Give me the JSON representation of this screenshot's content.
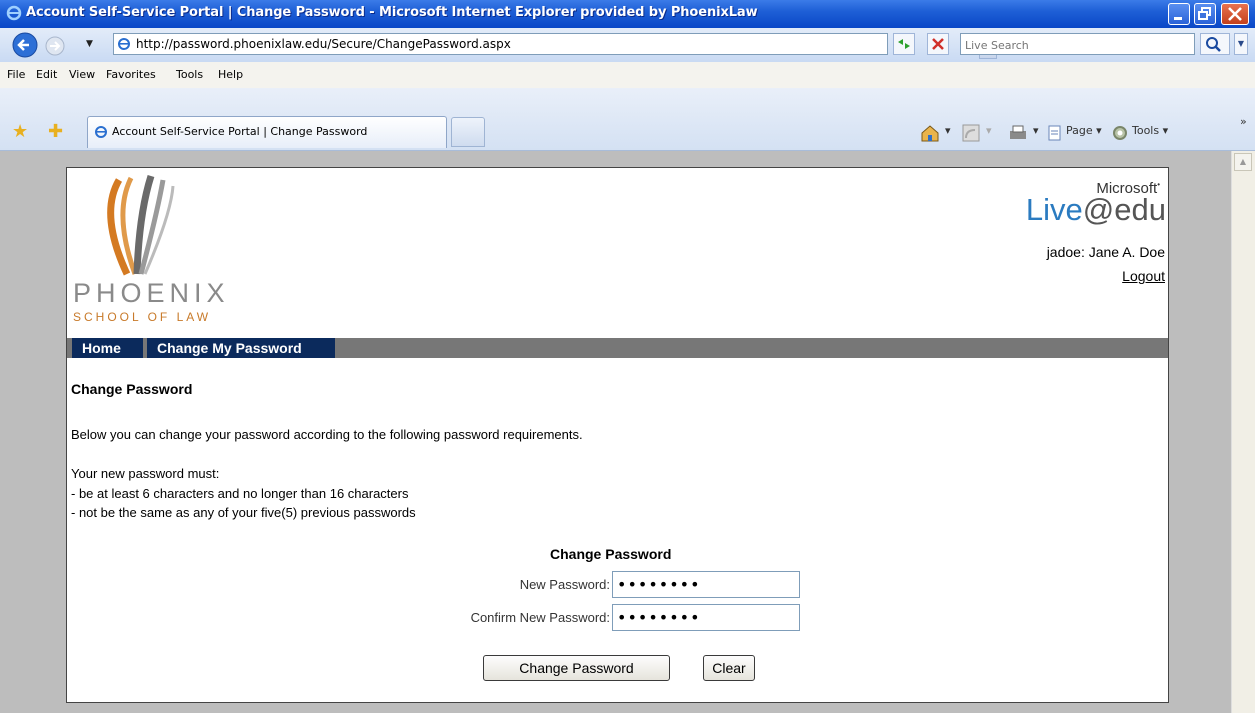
{
  "window": {
    "title": "Account Self-Service Portal | Change Password - Microsoft Internet Explorer provided by PhoenixLaw"
  },
  "address_bar": {
    "url": "http://password.phoenixlaw.edu/Secure/ChangePassword.aspx",
    "search_placeholder": "Live Search"
  },
  "menu": {
    "items": [
      "File",
      "Edit",
      "View",
      "Favorites",
      "Tools",
      "Help"
    ]
  },
  "tabs": {
    "active_label": "Account Self-Service Portal | Change Password"
  },
  "command_bar": {
    "page_label": "Page",
    "tools_label": "Tools",
    "more_label": "»"
  },
  "site": {
    "logo_name": "PHOENIX",
    "logo_sub": "SCHOOL OF LAW",
    "brand_microsoft": "Microsoft",
    "brand_live": "Live",
    "brand_at": "@edu",
    "user_text": "jadoe: Jane A. Doe",
    "logout_label": "Logout"
  },
  "nav": {
    "home_label": "Home",
    "change_label": "Change My Password"
  },
  "content": {
    "heading": "Change Password",
    "intro": "Below you can change your password according to the following password requirements.",
    "req_heading": "Your new password must:",
    "req_1": "- be at least 6 characters and no longer than 16 characters",
    "req_2": "- not be the same as any of your five(5) previous passwords"
  },
  "form": {
    "title": "Change Password",
    "new_label": "New Password:",
    "confirm_label": "Confirm New Password:",
    "new_value": "********",
    "confirm_value": "********",
    "submit_label": "Change Password",
    "clear_label": "Clear"
  },
  "colors": {
    "nav_tab": "#0b2a5c",
    "nav_bar": "#777777",
    "live_blue": "#2b7bc0",
    "logo_orange": "#c87a2a"
  }
}
